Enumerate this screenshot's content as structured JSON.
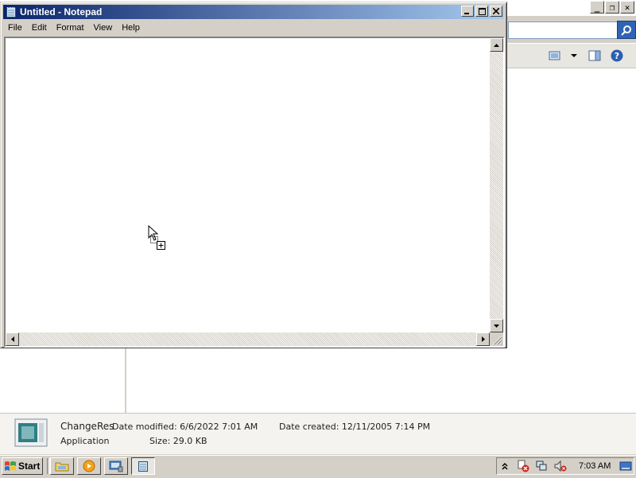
{
  "notepad": {
    "title": "Untitled - Notepad",
    "menu": [
      "File",
      "Edit",
      "Format",
      "View",
      "Help"
    ],
    "content": ""
  },
  "explorer": {
    "search_value": ""
  },
  "details": {
    "name": "ChangeRes",
    "type": "Application",
    "modified_label": "Date modified:",
    "modified_value": "6/6/2022 7:01 AM",
    "size_label": "Size:",
    "size_value": "29.0 KB",
    "created_label": "Date created:",
    "created_value": "12/11/2005 7:14 PM"
  },
  "taskbar": {
    "start_label": "Start",
    "clock": "7:03 AM"
  },
  "colors": {
    "titlebar_start": "#0a246a",
    "titlebar_end": "#a6caf0",
    "face": "#d4d0c8"
  }
}
